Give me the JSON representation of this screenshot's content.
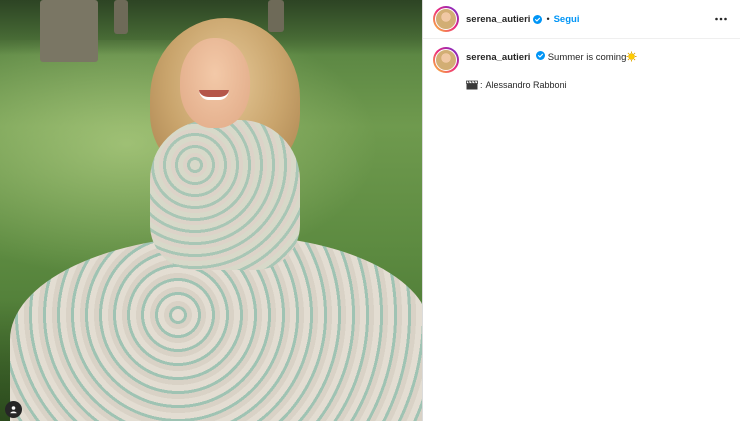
{
  "post": {
    "username": "serena_autieri",
    "separator": "•",
    "follow_label": "Segui",
    "caption": "Summer is coming",
    "caption_emoji": "sun-emoji",
    "credit_separator": ":",
    "credit_name": "Alessandro Rabboni",
    "credit_emoji": "clapper-board-emoji"
  },
  "icons": {
    "verified": "verified-badge-icon",
    "more": "more-options-icon",
    "tag": "user-tag-icon"
  },
  "colors": {
    "accent": "#0095f6",
    "text": "#262626",
    "divider": "#dbdbdb"
  }
}
